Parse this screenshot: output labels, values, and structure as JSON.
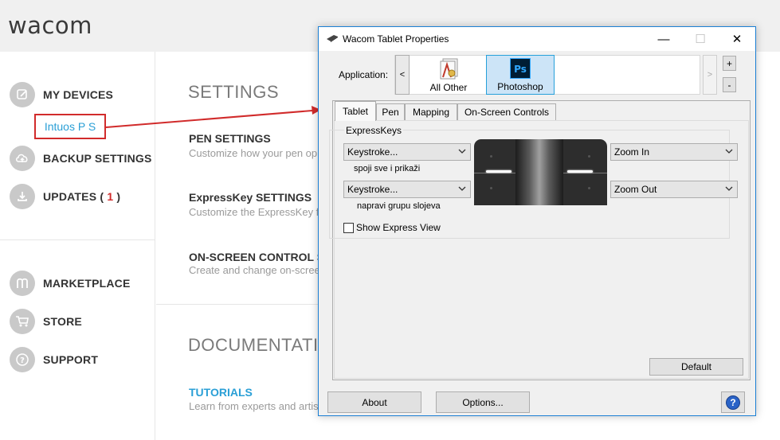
{
  "wacom_center": {
    "logo": "wacom",
    "sidebar": {
      "items": [
        {
          "label": "MY DEVICES",
          "icon": "edit-icon"
        },
        {
          "label": "BACKUP SETTINGS",
          "icon": "cloud-upload-icon"
        },
        {
          "label": "UPDATES ( ",
          "count": "1",
          "close": " )",
          "icon": "download-icon"
        },
        {
          "label": "MARKETPLACE",
          "icon": "marketplace-icon"
        },
        {
          "label": "STORE",
          "icon": "cart-icon"
        },
        {
          "label": "SUPPORT",
          "icon": "help-icon"
        }
      ],
      "device": "Intuos P S"
    },
    "main": {
      "settings_heading": "SETTINGS",
      "sections": [
        {
          "title": "PEN SETTINGS",
          "desc": "Customize how your pen op"
        },
        {
          "title": "ExpressKey SETTINGS",
          "desc": "Customize the ExpressKey fu"
        },
        {
          "title": "ON-SCREEN CONTROL SE",
          "desc": "Create and change on-scree"
        }
      ],
      "docs_heading": "DOCUMENTATIO",
      "tutorials": {
        "title": "TUTORIALS",
        "desc": "Learn from experts and artist"
      }
    },
    "colors": {
      "accent": "#2a9fd6",
      "highlight": "#d12b2b"
    }
  },
  "dialog": {
    "title": "Wacom Tablet Properties",
    "window_buttons": {
      "minimize": "—",
      "maximize": "☐",
      "close": "✕"
    },
    "application_label": "Application:",
    "scroll_left": "<",
    "scroll_right": ">",
    "apps": [
      {
        "name": "All Other",
        "icon": "all-other-icon",
        "selected": false
      },
      {
        "name": "Photoshop",
        "icon": "photoshop-icon",
        "selected": true
      }
    ],
    "add_app": "+",
    "remove_app": "-",
    "tabs": [
      "Tablet",
      "Pen",
      "Mapping",
      "On-Screen Controls"
    ],
    "active_tab": "Tablet",
    "expresskeys": {
      "group_label": "ExpressKeys",
      "left": [
        {
          "value": "Keystroke...",
          "caption": "spoji sve i prikaži"
        },
        {
          "value": "Keystroke...",
          "caption": "napravi grupu slojeva"
        }
      ],
      "right": [
        {
          "value": "Zoom In"
        },
        {
          "value": "Zoom Out"
        }
      ]
    },
    "show_express_view": {
      "label": "Show Express View",
      "checked": false
    },
    "default_button": "Default",
    "about_button": "About",
    "options_button": "Options...",
    "help_button": "?"
  }
}
